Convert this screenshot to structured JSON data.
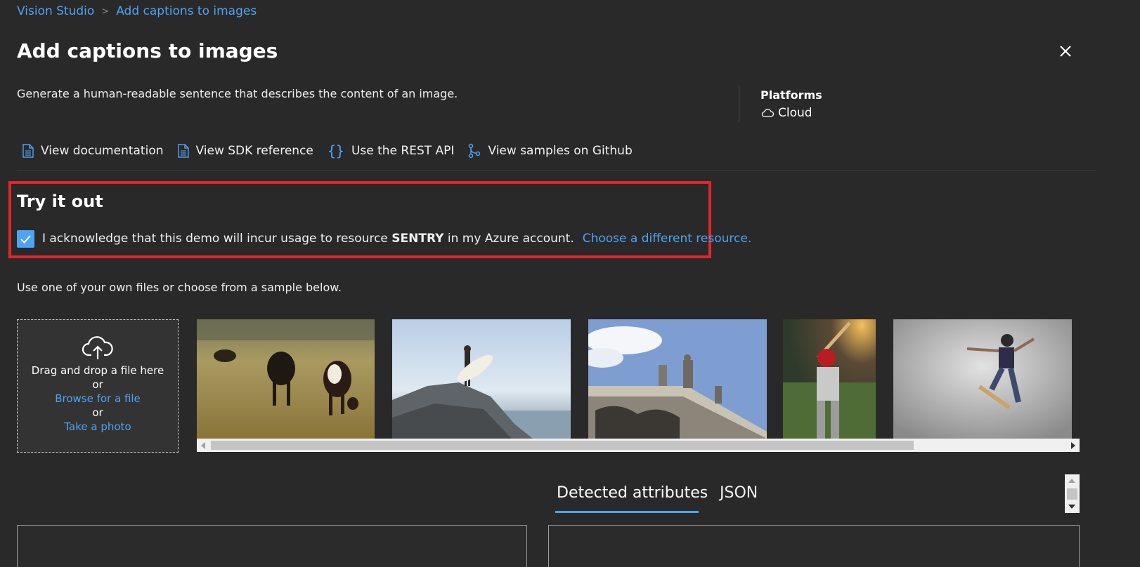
{
  "breadcrumb": {
    "items": [
      "Vision Studio",
      "Add captions to images"
    ],
    "separator": ">"
  },
  "page": {
    "title": "Add captions to images",
    "description": "Generate a human-readable sentence that describes the content of an image."
  },
  "platforms": {
    "label": "Platforms",
    "value": "Cloud",
    "icon": "cloud-icon"
  },
  "links": [
    {
      "label": "View documentation",
      "icon": "document-icon"
    },
    {
      "label": "View SDK reference",
      "icon": "document-icon"
    },
    {
      "label": "Use the REST API",
      "icon": "braces-icon"
    },
    {
      "label": "View samples on Github",
      "icon": "branch-icon"
    }
  ],
  "try_it": {
    "title": "Try it out",
    "checked": true,
    "ack_prefix": "I acknowledge that this demo will incur usage to resource ",
    "resource": "SENTRY",
    "ack_suffix": " in my Azure account.",
    "change_link": "Choose a different resource."
  },
  "upload": {
    "instructions": "Use one of your own files or choose from a sample below.",
    "drag_text": "Drag and drop a file here",
    "or_1": "or",
    "browse_link": "Browse for a file",
    "or_2": "or",
    "photo_link": "Take a photo",
    "icon": "cloud-upload-icon"
  },
  "samples": [
    "cows grazing",
    "surfer on rock",
    "building statues",
    "baseball batter",
    "skateboarder"
  ],
  "tabs": {
    "detected": "Detected attributes",
    "json": "JSON",
    "active": "Detected attributes"
  },
  "colors": {
    "background": "#292929",
    "accent": "#4ea3f5",
    "highlight_border": "#e2252b"
  }
}
